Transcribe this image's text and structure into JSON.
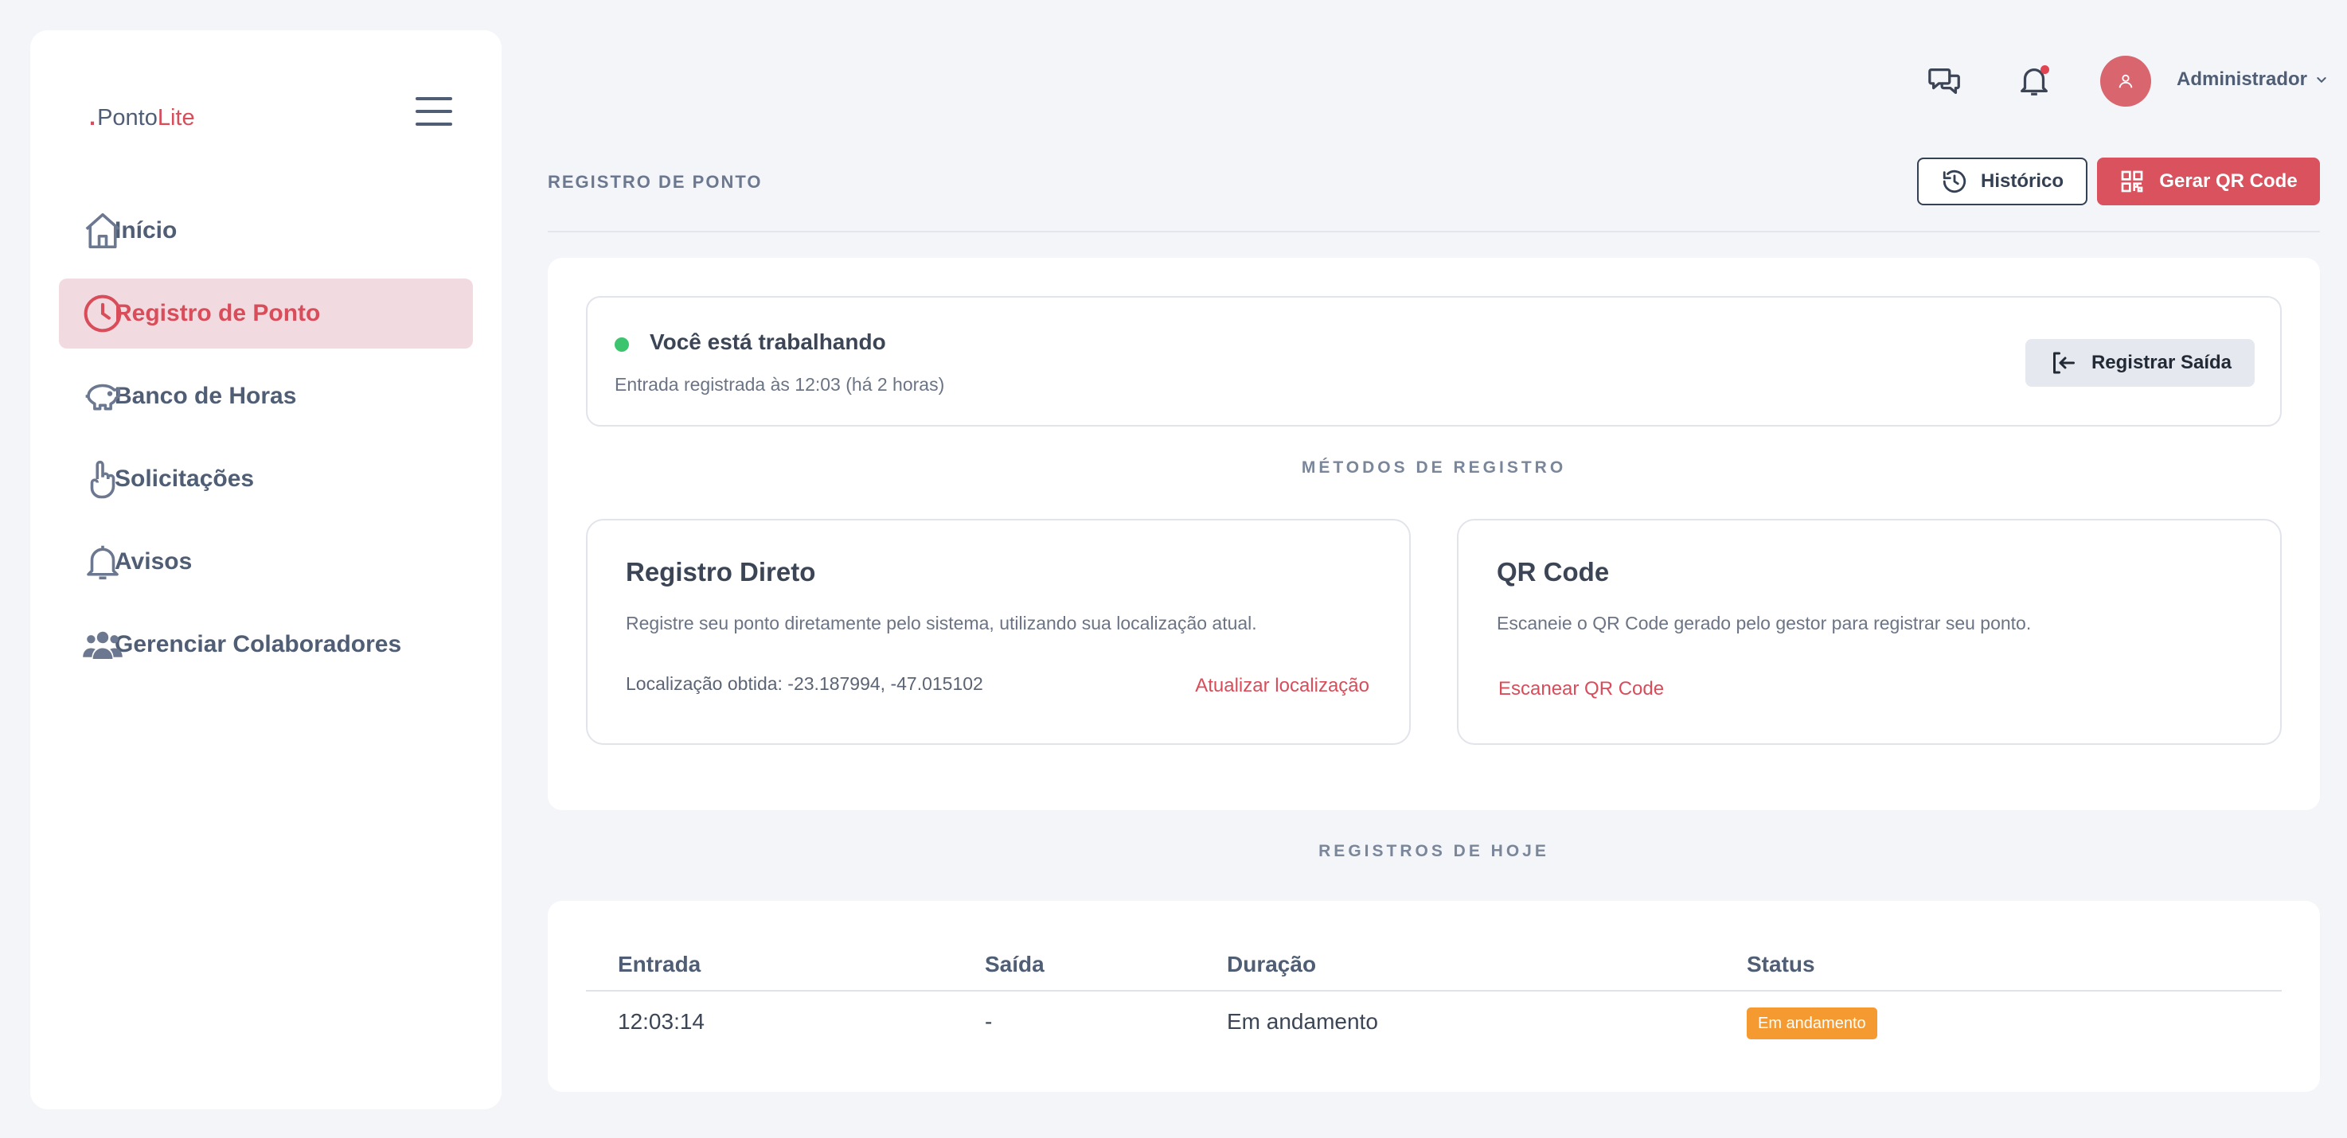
{
  "brand": {
    "dot": ".",
    "name_part1": "Ponto",
    "name_part2": "Lite"
  },
  "sidebar": {
    "items": [
      {
        "label": "Início",
        "icon": "home-icon",
        "active": false
      },
      {
        "label": "Registro de Ponto",
        "icon": "clock-icon",
        "active": true
      },
      {
        "label": "Banco de Horas",
        "icon": "piggy-bank-icon",
        "active": false
      },
      {
        "label": "Solicitações",
        "icon": "hand-pointer-icon",
        "active": false
      },
      {
        "label": "Avisos",
        "icon": "bell-icon",
        "active": false
      },
      {
        "label": "Gerenciar Colaboradores",
        "icon": "users-icon",
        "active": false
      }
    ]
  },
  "header": {
    "user_name": "Administrador",
    "page_title": "REGISTRO DE PONTO",
    "history_button": "Histórico",
    "qr_button": "Gerar QR Code"
  },
  "status": {
    "title": "Você está trabalhando",
    "subtitle": "Entrada registrada às 12:03 (há 2 horas)",
    "exit_button": "Registrar Saída"
  },
  "methods": {
    "section_label": "MÉTODOS DE REGISTRO",
    "direct": {
      "title": "Registro Direto",
      "description": "Registre seu ponto diretamente pelo sistema, utilizando sua localização atual.",
      "location": "Localização obtida: -23.187994, -47.015102",
      "link": "Atualizar localização"
    },
    "qr": {
      "title": "QR Code",
      "description": "Escaneie o QR Code gerado pelo gestor para registrar seu ponto.",
      "link": "Escanear QR Code"
    }
  },
  "today": {
    "section_label": "REGISTROS DE HOJE",
    "columns": [
      "Entrada",
      "Saída",
      "Duração",
      "Status"
    ],
    "rows": [
      {
        "entrada": "12:03:14",
        "saida": "-",
        "duracao": "Em andamento",
        "status": "Em andamento"
      }
    ]
  },
  "colors": {
    "accent": "#d94c5a",
    "active_bg": "#f2dbe0",
    "status_green": "#3cc46e",
    "badge_orange": "#f49a30"
  }
}
